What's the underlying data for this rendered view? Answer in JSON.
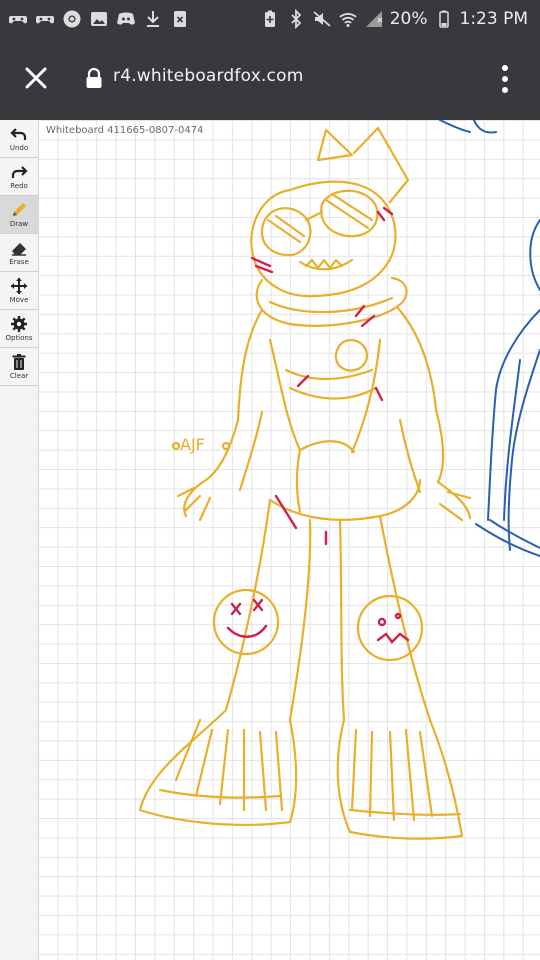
{
  "status_bar": {
    "battery": "20%",
    "time": "1:23 PM"
  },
  "browser": {
    "url": "r4.whiteboardfox.com"
  },
  "board": {
    "title": "Whiteboard 411665-0807-0474",
    "sketch_signature": "AJF"
  },
  "toolbar": {
    "tools": [
      {
        "label": "Undo",
        "icon": "undo-icon"
      },
      {
        "label": "Redo",
        "icon": "redo-icon"
      },
      {
        "label": "Draw",
        "icon": "pencil-icon",
        "active": true
      },
      {
        "label": "Erase",
        "icon": "eraser-icon"
      },
      {
        "label": "Move",
        "icon": "move-icon"
      },
      {
        "label": "Options",
        "icon": "gear-icon"
      },
      {
        "label": "Clear",
        "icon": "trash-icon"
      }
    ]
  },
  "colors": {
    "chrome": "#37393d",
    "sketch_yellow": "#e8b02a",
    "sketch_red": "#d0214a",
    "sketch_blue": "#2a5fb0"
  }
}
